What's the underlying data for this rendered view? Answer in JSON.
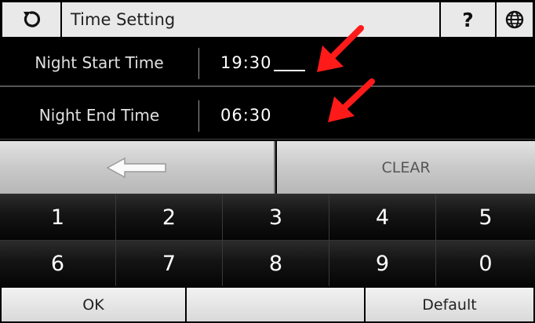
{
  "header": {
    "title": "Time Setting",
    "help_label": "?",
    "icons": [
      "refresh-icon",
      "help-icon",
      "globe-icon"
    ]
  },
  "time_settings": {
    "start": {
      "label": "Night Start Time",
      "value": "19:30"
    },
    "end": {
      "label": "Night End Time",
      "value": "06:30"
    }
  },
  "keypad": {
    "clear_label": "CLEAR",
    "digits_row1": [
      "1",
      "2",
      "3",
      "4",
      "5"
    ],
    "digits_row2": [
      "6",
      "7",
      "8",
      "9",
      "0"
    ]
  },
  "footer": {
    "ok_label": "OK",
    "default_label": "Default"
  },
  "annotations": {
    "arrow_color": "#ff1a1a"
  }
}
